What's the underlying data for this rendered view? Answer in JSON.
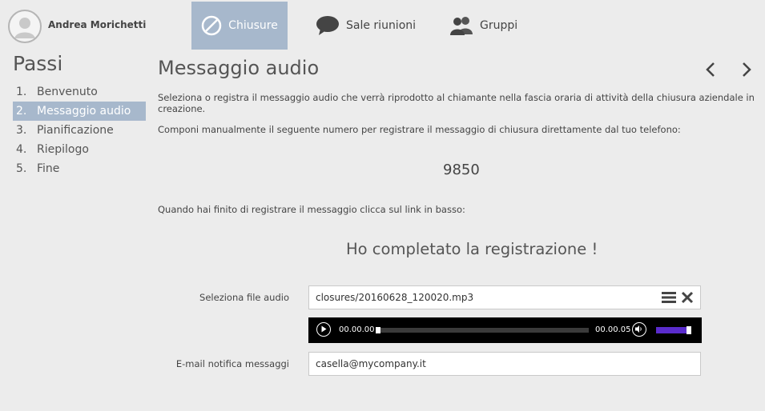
{
  "user": {
    "name": "Andrea Morichetti",
    "avatar_icon": "user-avatar-icon"
  },
  "tabs": [
    {
      "label": "Chiusure",
      "icon": "ban-icon",
      "active": true
    },
    {
      "label": "Sale riunioni",
      "icon": "chat-bubble-icon",
      "active": false
    },
    {
      "label": "Gruppi",
      "icon": "users-icon",
      "active": false
    }
  ],
  "steps": {
    "title": "Passi",
    "items": [
      {
        "num": "1.",
        "label": "Benvenuto"
      },
      {
        "num": "2.",
        "label": "Messaggio audio",
        "active": true
      },
      {
        "num": "3.",
        "label": "Pianificazione"
      },
      {
        "num": "4.",
        "label": "Riepilogo"
      },
      {
        "num": "5.",
        "label": "Fine"
      }
    ]
  },
  "main": {
    "title": "Messaggio audio",
    "intro": "Seleziona o registra il messaggio audio che verrà riprodotto al chiamante nella fascia oraria di attività della chiusura aziendale in creazione.",
    "dial_instructions": "Componi manualmente il seguente numero per registrare il messaggio di chiusura direttamente dal tuo telefono:",
    "phone_number": "9850",
    "finish_instructions": "Quando hai finito di registrare il messaggio clicca sul link in basso:",
    "done_link": "Ho completato la registrazione !"
  },
  "form": {
    "file_label": "Seleziona file audio",
    "file_value": "closures/20160628_120020.mp3",
    "email_label": "E-mail notifica messaggi",
    "email_value": "casella@mycompany.it"
  },
  "player": {
    "current_time": "00.00.00",
    "duration": "00.00.05",
    "progress": 0,
    "volume": 0.95
  },
  "colors": {
    "active_tab": "#a7b8cc",
    "background": "#ececec",
    "volume_bar": "#5a2ccd"
  }
}
